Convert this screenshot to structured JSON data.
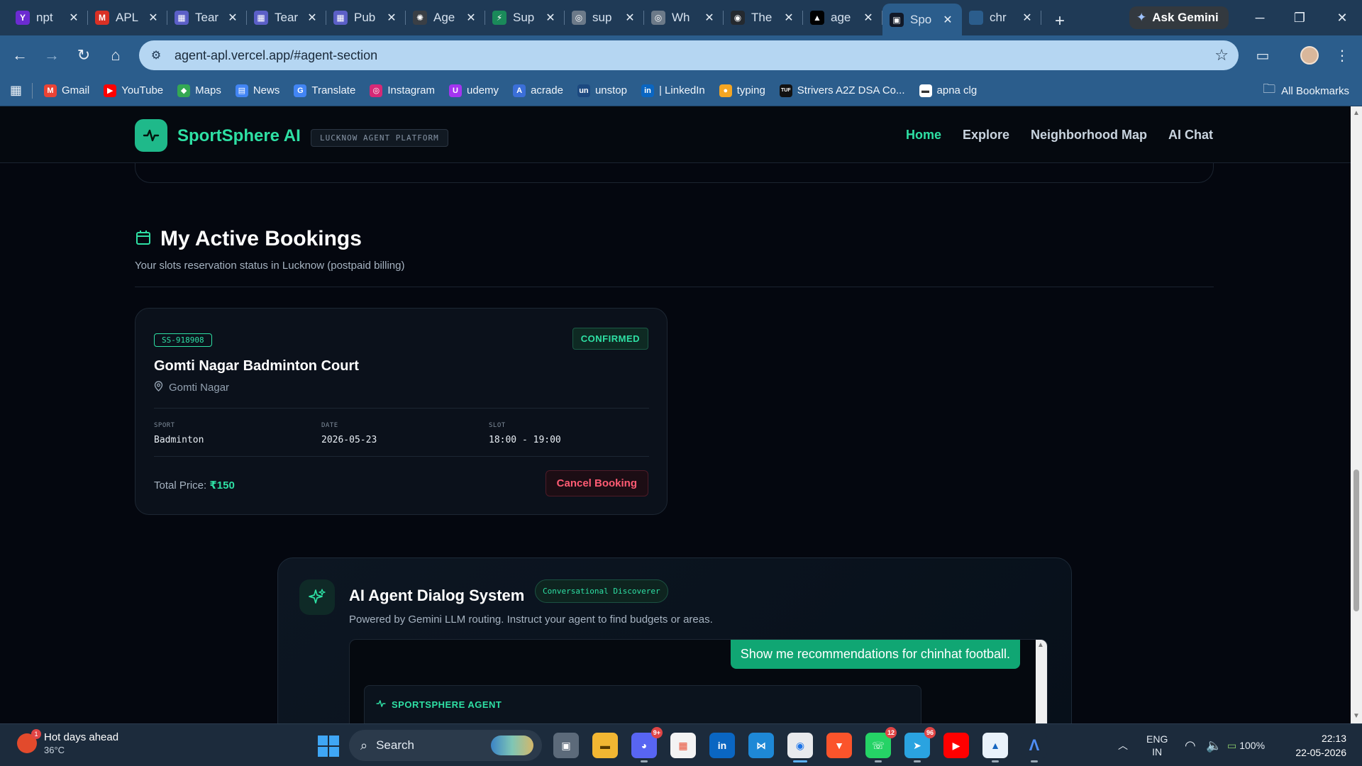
{
  "browser": {
    "tabs": [
      {
        "title": "npt",
        "fav_color": "#6b2bd1",
        "fav_glyph": "Y"
      },
      {
        "title": "APL",
        "fav_color": "#d93025",
        "fav_glyph": "M"
      },
      {
        "title": "Tear",
        "fav_color": "#5b5fc7",
        "fav_glyph": "▦"
      },
      {
        "title": "Tear",
        "fav_color": "#5b5fc7",
        "fav_glyph": "▦"
      },
      {
        "title": "Pub",
        "fav_color": "#5b5fc7",
        "fav_glyph": "▦"
      },
      {
        "title": "Age",
        "fav_color": "#3a3f45",
        "fav_glyph": "✺"
      },
      {
        "title": "Sup",
        "fav_color": "#1a8a5a",
        "fav_glyph": "⚡"
      },
      {
        "title": "sup",
        "fav_color": "#6c7a89",
        "fav_glyph": "◎"
      },
      {
        "title": "Wh",
        "fav_color": "#6c7a89",
        "fav_glyph": "◎"
      },
      {
        "title": "The",
        "fav_color": "#24292f",
        "fav_glyph": "◉"
      },
      {
        "title": "age",
        "fav_color": "#000000",
        "fav_glyph": "▲"
      },
      {
        "title": "Spo",
        "fav_color": "#111827",
        "fav_glyph": "▣",
        "active": true
      },
      {
        "title": "chr",
        "fav_color": "#2b5d8c",
        "fav_glyph": ""
      }
    ],
    "gemini_label": "Ask Gemini",
    "url": "agent-apl.vercel.app/#agent-section",
    "bookmarks": [
      {
        "label": "Gmail",
        "color": "#ea4335",
        "glyph": "M"
      },
      {
        "label": "YouTube",
        "color": "#ff0000",
        "glyph": "▶"
      },
      {
        "label": "Maps",
        "color": "#34a853",
        "glyph": "◆"
      },
      {
        "label": "News",
        "color": "#4285f4",
        "glyph": "▤"
      },
      {
        "label": "Translate",
        "color": "#4285f4",
        "glyph": "G"
      },
      {
        "label": "Instagram",
        "color": "#d62976",
        "glyph": "◎"
      },
      {
        "label": "udemy",
        "color": "#a435f0",
        "glyph": "U"
      },
      {
        "label": "acrade",
        "color": "#3b6fd8",
        "glyph": "A"
      },
      {
        "label": "unstop",
        "color": "#1c4980",
        "glyph": "un"
      },
      {
        "label": "| LinkedIn",
        "color": "#0a66c2",
        "glyph": "in"
      },
      {
        "label": "typing",
        "color": "#f5a623",
        "glyph": "●"
      },
      {
        "label": "Strivers A2Z DSA Co...",
        "color": "#111111",
        "glyph": "TUF"
      },
      {
        "label": "apna clg",
        "color": "#ffffff",
        "glyph": "▬"
      }
    ],
    "all_bookmarks": "All Bookmarks"
  },
  "site": {
    "brand": "SportSphere AI",
    "platform_badge": "LUCKNOW AGENT PLATFORM",
    "nav": [
      "Home",
      "Explore",
      "Neighborhood Map",
      "AI Chat"
    ],
    "accent": "#2ee0a4"
  },
  "bookings": {
    "title": "My Active Bookings",
    "subtitle": "Your slots reservation status in Lucknow (postpaid billing)",
    "card": {
      "id": "SS-918908",
      "status": "CONFIRMED",
      "venue": "Gomti Nagar Badminton Court",
      "location": "Gomti Nagar",
      "sport_label": "SPORT",
      "sport": "Badminton",
      "date_label": "DATE",
      "date": "2026-05-23",
      "slot_label": "SLOT",
      "slot": "18:00 - 19:00",
      "price_label": "Total Price:",
      "price": "₹150",
      "cancel_label": "Cancel Booking"
    }
  },
  "agent": {
    "title": "AI Agent Dialog System",
    "badge": "Conversational Discoverer",
    "subtitle": "Powered by Gemini LLM routing. Instruct your agent to find budgets or areas.",
    "user_message": "Show me recommendations for chinhat football.",
    "agent_name": "SPORTSPHERE AGENT"
  },
  "taskbar": {
    "weather_title": "Hot days ahead",
    "weather_temp": "36°C",
    "search_placeholder": "Search",
    "lang_top": "ENG",
    "lang_bottom": "IN",
    "battery": "100%",
    "time": "22:13",
    "date": "22-05-2026",
    "badges": {
      "discord": "9+",
      "whatsapp": "12",
      "telegram": "96"
    }
  }
}
